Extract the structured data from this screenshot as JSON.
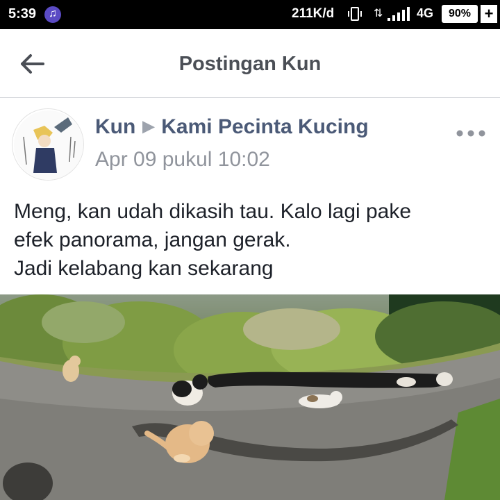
{
  "status_bar": {
    "time": "5:39",
    "speed": "211K/d",
    "network": "4G",
    "battery": "90%",
    "battery_extra": "+"
  },
  "header": {
    "title": "Postingan Kun"
  },
  "post": {
    "author": "Kun",
    "group": "Kami Pecinta Kucing",
    "timestamp": "Apr 09 pukul 10:02",
    "text_lines": [
      "Meng, kan udah dikasih tau. Kalo lagi pake",
      "efek panorama, jangan gerak.",
      "Jadi kelabang kan sekarang"
    ]
  },
  "icons": {
    "back": "arrow-left-icon",
    "more": "more-dots-icon",
    "music": "music-note-icon"
  },
  "colors": {
    "author_link": "#4b5a77",
    "meta_gray": "#90949c",
    "header_title": "#4b4f56"
  }
}
